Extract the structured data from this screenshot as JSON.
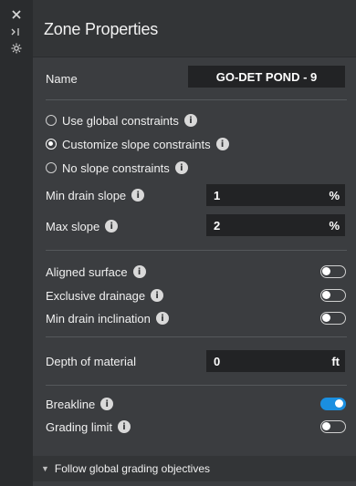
{
  "rail": {
    "icons": [
      "close-icon",
      "collapse-icon",
      "settings-icon"
    ]
  },
  "panel": {
    "title": "Zone Properties",
    "name": {
      "label": "Name",
      "value": "GO-DET POND - 9"
    },
    "constraints": {
      "options": [
        {
          "label": "Use global constraints",
          "selected": false
        },
        {
          "label": "Customize slope constraints",
          "selected": true
        },
        {
          "label": "No slope constraints",
          "selected": false
        }
      ]
    },
    "min_drain_slope": {
      "label": "Min drain slope",
      "value": "1",
      "unit": "%"
    },
    "max_slope": {
      "label": "Max slope",
      "value": "2",
      "unit": "%"
    },
    "aligned_surface": {
      "label": "Aligned surface",
      "on": false
    },
    "exclusive_drainage": {
      "label": "Exclusive drainage",
      "on": false
    },
    "min_drain_inclination": {
      "label": "Min drain inclination",
      "on": false
    },
    "depth": {
      "label": "Depth of material",
      "value": "0",
      "unit": "ft"
    },
    "breakline": {
      "label": "Breakline",
      "on": true
    },
    "grading_limit": {
      "label": "Grading limit",
      "on": false
    },
    "footer": {
      "label": "Follow global grading objectives"
    },
    "info_glyph": "i"
  },
  "colors": {
    "accent": "#1a8fe0",
    "panel_bg": "#3b3d40",
    "field_bg": "#222325"
  }
}
